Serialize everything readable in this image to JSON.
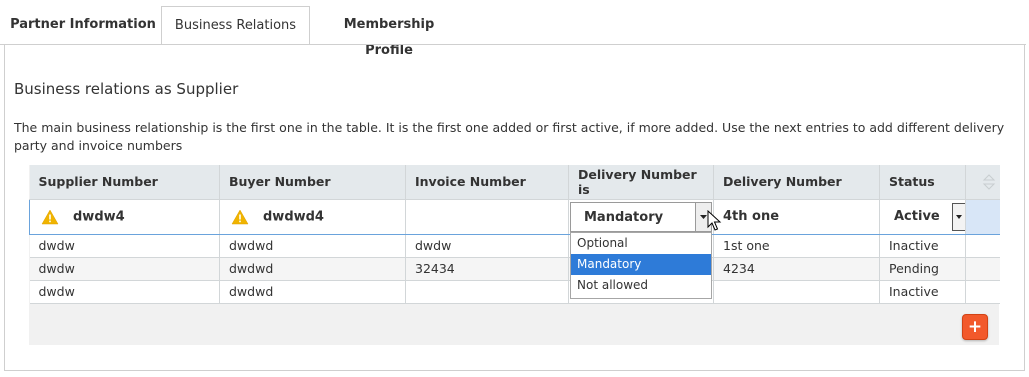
{
  "tabs": [
    {
      "label": "Partner Information",
      "active": false
    },
    {
      "label": "Business Relations",
      "active": true
    },
    {
      "label": "Membership Profile",
      "active": false
    }
  ],
  "section": {
    "title": "Business relations as Supplier",
    "description": "The main business relationship is the first one in the table. It is the first one added or first active, if more added. Use the next entries to add different delivery party and invoice numbers"
  },
  "grid": {
    "columns": [
      "Supplier Number",
      "Buyer Number",
      "Invoice Number",
      "Delivery Number is",
      "Delivery Number",
      "Status"
    ],
    "edit_row": {
      "supplier_number": "dwdw4",
      "buyer_number": "dwdwd4",
      "invoice_number": "",
      "delivery_number_is": "Mandatory",
      "delivery_number": "4th one",
      "status": "Active"
    },
    "rows": [
      {
        "supplier_number": "dwdw",
        "buyer_number": "dwdwd",
        "invoice_number": "dwdw",
        "delivery_number_is": "",
        "delivery_number": "1st one",
        "status": "Inactive"
      },
      {
        "supplier_number": "dwdw",
        "buyer_number": "dwdwd",
        "invoice_number": "32434",
        "delivery_number_is": "",
        "delivery_number": "4234",
        "status": "Pending"
      },
      {
        "supplier_number": "dwdw",
        "buyer_number": "dwdwd",
        "invoice_number": "",
        "delivery_number_is": "",
        "delivery_number": "",
        "status": "Inactive"
      }
    ]
  },
  "dropdown": {
    "options": [
      "Optional",
      "Mandatory",
      "Not allowed"
    ],
    "selected": "Mandatory"
  },
  "icons": {
    "warning": "warning-icon",
    "add": "add-icon",
    "sort": "sort-icon",
    "cursor": "mouse-cursor-icon"
  },
  "colors": {
    "warning": "#f0b400",
    "accent_blue": "#2e7bd8",
    "add_button": "#f2592b",
    "header_bg": "#e4e9ec"
  }
}
